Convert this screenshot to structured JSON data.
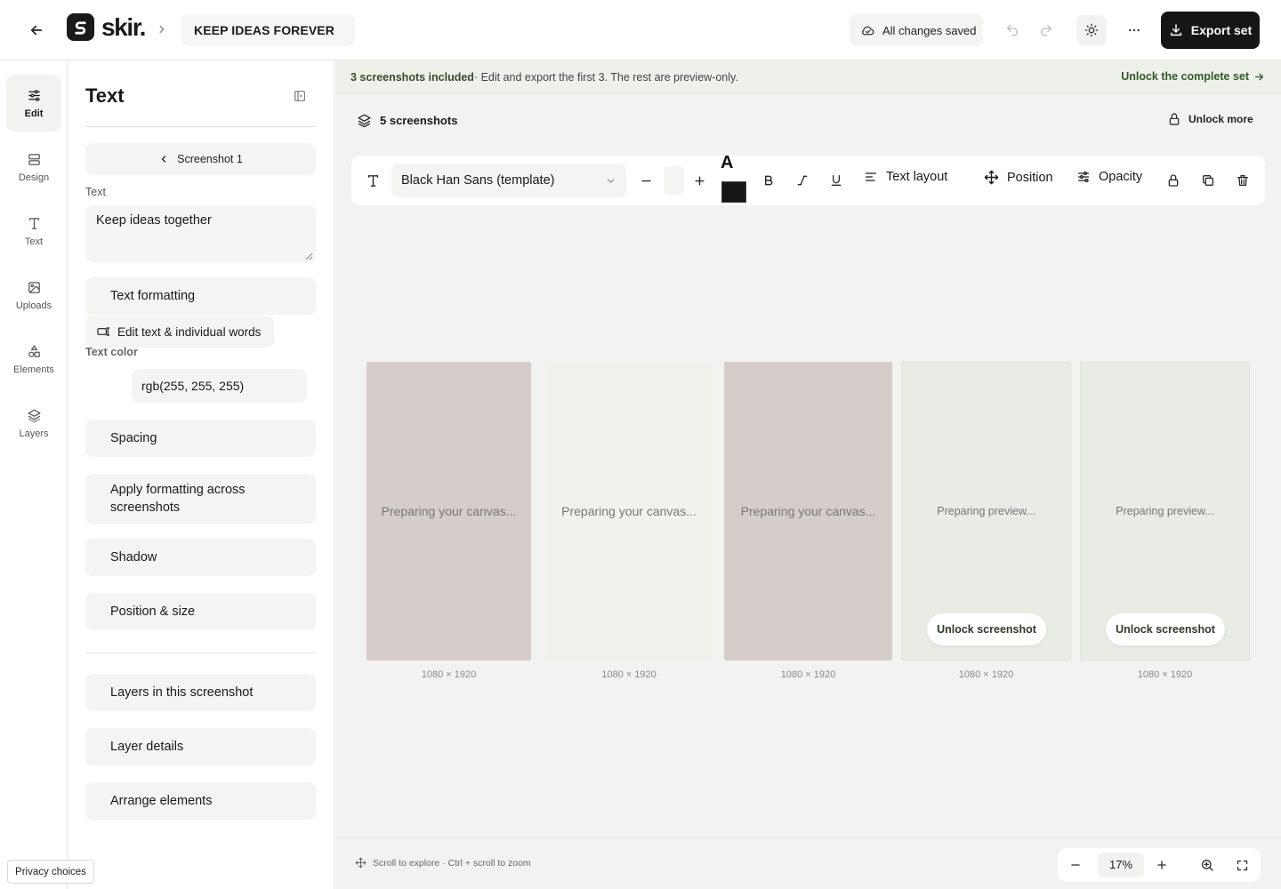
{
  "header": {
    "logo_text": "skir.",
    "project_name": "KEEP IDEAS FOREVER",
    "save_status": "All changes saved",
    "export_label": "Export set"
  },
  "rail": {
    "items": [
      {
        "label": "Edit",
        "icon": "sliders-icon"
      },
      {
        "label": "Design",
        "icon": "layout-icon"
      },
      {
        "label": "Text",
        "icon": "text-icon"
      },
      {
        "label": "Uploads",
        "icon": "image-icon"
      },
      {
        "label": "Elements",
        "icon": "shapes-icon"
      },
      {
        "label": "Layers",
        "icon": "layers-icon"
      }
    ]
  },
  "panel": {
    "title": "Text",
    "screenshot_nav": "Screenshot 1",
    "text_label": "Text",
    "text_value": "Keep ideas together",
    "text_formatting": "Text formatting",
    "edit_words": "Edit text & individual words",
    "color_label": "Text color",
    "color_value": "rgb(255, 255, 255)",
    "spacing": "Spacing",
    "apply_formatting": "Apply formatting across screenshots",
    "shadow": "Shadow",
    "position_size": "Position & size",
    "layers_in_screenshot": "Layers in this screenshot",
    "layer_details": "Layer details",
    "arrange_elements": "Arrange elements"
  },
  "banner": {
    "bold": "3 screenshots included",
    "text": " · Edit and export the first 3. The rest are preview-only.",
    "link": "Unlock the complete set"
  },
  "canvas": {
    "count_label": "5 screenshots",
    "unlock_more": "Unlock more",
    "screenshots": [
      {
        "status": "Preparing your canvas...",
        "size": "1080 × 1920",
        "locked": false,
        "color": "#d5cdca"
      },
      {
        "status": "Preparing your canvas...",
        "size": "1080 × 1920",
        "locked": false,
        "color": "#f1f2ec"
      },
      {
        "status": "Preparing your canvas...",
        "size": "1080 × 1920",
        "locked": false,
        "color": "#d5cdca"
      },
      {
        "status": "Preparing preview...",
        "size": "1080 × 1920",
        "locked": true,
        "unlock_label": "Unlock screenshot",
        "color": "#e9ebe5"
      },
      {
        "status": "Preparing preview...",
        "size": "1080 × 1920",
        "locked": true,
        "unlock_label": "Unlock screenshot",
        "color": "#e9ebe5"
      }
    ]
  },
  "toolbar": {
    "font_name": "Black Han Sans (template)",
    "color_letter": "A",
    "text_layout": "Text layout",
    "position": "Position",
    "opacity": "Opacity",
    "swatch_color": "#151515"
  },
  "footer": {
    "hint": "Scroll to explore · Ctrl + scroll to zoom",
    "zoom": "17%"
  },
  "privacy": "Privacy choices"
}
